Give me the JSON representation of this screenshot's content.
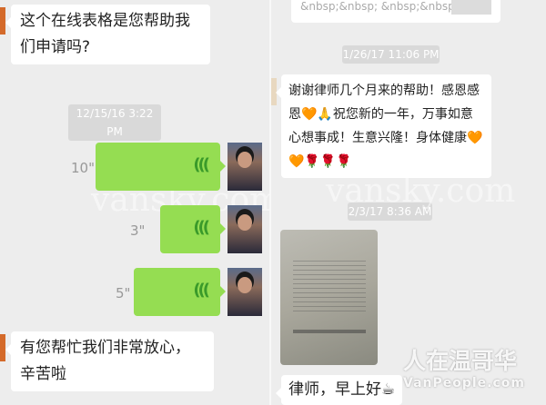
{
  "left": {
    "msg1": "这个在线表格是您帮助我们申请吗?",
    "timestamp": "12/15/16 3:22 PM",
    "voices": [
      {
        "duration": "10\""
      },
      {
        "duration": "3\""
      },
      {
        "duration": "5\""
      }
    ],
    "msg2": "有您帮忙我们非常放心，辛苦啦",
    "watermark": "vansky.com"
  },
  "right": {
    "top_snippet": "&nbsp;&nbsp; &nbsp;&nbsp;...",
    "timestamp1": "1/26/17 11:06 PM",
    "msg1": "谢谢律师几个月来的帮助！感恩感恩🧡🙏祝您新的一年，万事如意心想事成！生意兴隆！身体健康🧡🧡🌹🌹🌹",
    "timestamp2": "2/3/17 8:36 AM",
    "msg2": "律师，早上好☕",
    "watermark": "vansky.com",
    "logo_cn": "人在温哥华",
    "logo_en": "VanPeople.com"
  }
}
